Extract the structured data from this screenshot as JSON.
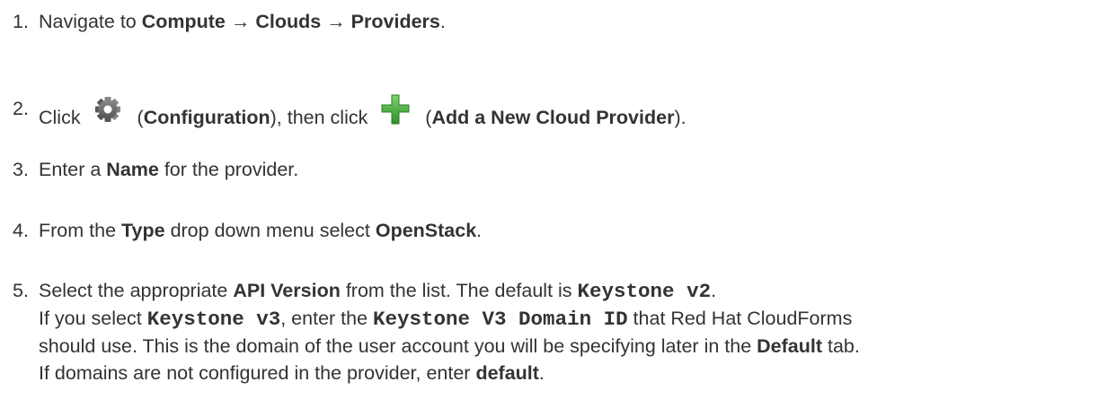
{
  "steps": [
    {
      "num": "1.",
      "t1": "Navigate to ",
      "b1": "Compute",
      "t2": " → ",
      "b2": "Clouds",
      "t3": " → ",
      "b3": "Providers",
      "t4": "."
    },
    {
      "num": "2.",
      "t1": "Click ",
      "icon1": "gear-icon",
      "t2": " (",
      "b1": "Configuration",
      "t3": "), then click ",
      "icon2": "green-plus-icon",
      "t4": " (",
      "b2": "Add a New Cloud Provider",
      "t5": ")."
    },
    {
      "num": "3.",
      "t1": "Enter a ",
      "b1": "Name",
      "t2": " for the provider."
    },
    {
      "num": "4.",
      "t1": "From the ",
      "b1": "Type",
      "t2": " drop down menu select ",
      "b2": "OpenStack",
      "t3": "."
    },
    {
      "num": "5.",
      "t1": "Select the appropriate ",
      "b1": "API Version",
      "t2": " from the list. The default is ",
      "c1": "Keystone v2",
      "t3": ".",
      "l2_t1": "If you select ",
      "l2_c1": "Keystone v3",
      "l2_t2": ", enter the ",
      "l2_c2": "Keystone V3 Domain ID",
      "l2_t3": " that Red Hat CloudForms",
      "l3_t1": "should use. This is the domain of the user account you will be specifying later in the ",
      "l3_b1": "Default",
      "l3_t2": " tab.",
      "l4_t1": "If domains are not configured in the provider, enter ",
      "l4_b1": "default",
      "l4_t2": "."
    }
  ],
  "colors": {
    "text": "#333333",
    "icon_gray": "#6b6b6b",
    "icon_green": "#3faa35"
  }
}
